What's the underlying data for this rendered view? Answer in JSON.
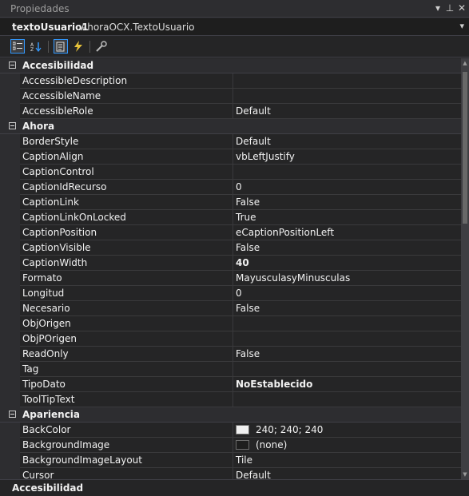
{
  "panel": {
    "title": "Propiedades",
    "pin_icon": "pin-icon",
    "close_icon": "close-icon",
    "menu_icon": "dropdown-icon"
  },
  "object": {
    "name": "textoUsuario1",
    "type": "AhoraOCX.TextoUsuario"
  },
  "toolbar": {
    "buttons": [
      "categorized-view-icon",
      "alphabetical-view-icon",
      "properties-view-icon",
      "events-view-icon",
      "property-pages-icon"
    ]
  },
  "grid": {
    "categories": [
      {
        "name": "Accesibilidad",
        "properties": [
          {
            "name": "AccessibleDescription",
            "value": ""
          },
          {
            "name": "AccessibleName",
            "value": ""
          },
          {
            "name": "AccessibleRole",
            "value": "Default"
          }
        ]
      },
      {
        "name": "Ahora",
        "properties": [
          {
            "name": "BorderStyle",
            "value": "Default"
          },
          {
            "name": "CaptionAlign",
            "value": "vbLeftJustify"
          },
          {
            "name": "CaptionControl",
            "value": ""
          },
          {
            "name": "CaptionIdRecurso",
            "value": "0"
          },
          {
            "name": "CaptionLink",
            "value": "False"
          },
          {
            "name": "CaptionLinkOnLocked",
            "value": "True"
          },
          {
            "name": "CaptionPosition",
            "value": "eCaptionPositionLeft"
          },
          {
            "name": "CaptionVisible",
            "value": "False"
          },
          {
            "name": "CaptionWidth",
            "value": "40",
            "bold": true
          },
          {
            "name": "Formato",
            "value": "MayusculasyMinusculas"
          },
          {
            "name": "Longitud",
            "value": "0"
          },
          {
            "name": "Necesario",
            "value": "False"
          },
          {
            "name": "ObjOrigen",
            "value": ""
          },
          {
            "name": "ObjPOrigen",
            "value": ""
          },
          {
            "name": "ReadOnly",
            "value": "False"
          },
          {
            "name": "Tag",
            "value": ""
          },
          {
            "name": "TipoDato",
            "value": "NoEstablecido",
            "bold": true
          },
          {
            "name": "ToolTipText",
            "value": ""
          }
        ]
      },
      {
        "name": "Apariencia",
        "properties": [
          {
            "name": "BackColor",
            "value": "240; 240; 240",
            "swatch": "#f0f0f0"
          },
          {
            "name": "BackgroundImage",
            "value": "(none)",
            "swatch": "#1e1e1e"
          },
          {
            "name": "BackgroundImageLayout",
            "value": "Tile"
          },
          {
            "name": "Cursor",
            "value": "Default"
          }
        ]
      }
    ]
  },
  "description": {
    "title": "Accesibilidad"
  }
}
